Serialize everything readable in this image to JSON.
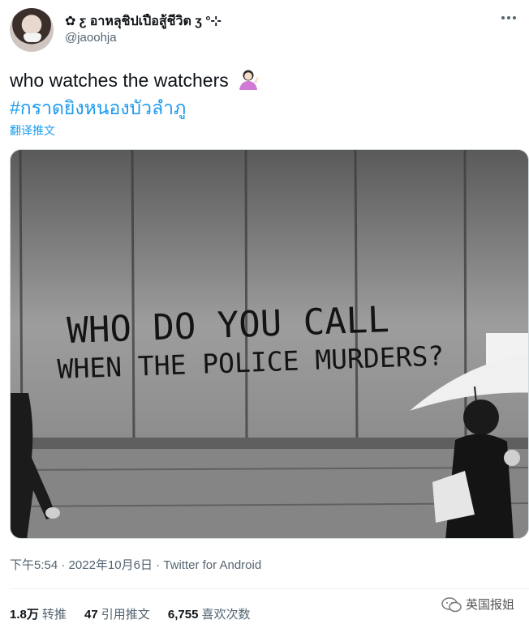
{
  "author": {
    "display_name": "✿ ƹ อาหลุชิปเปือสู้ชีวิต ʒ °⊹",
    "handle": "@jaoohja"
  },
  "tweet": {
    "text": "who watches the watchers",
    "emoji": "person-tipping-hand-emoji",
    "hashtag": "#กราดยิงหนองบัวลำภู",
    "translate_label": "翻译推文"
  },
  "photo": {
    "graffiti_line1": "WHO DO YOU CALL",
    "graffiti_line2": "WHEN THE POLICE MURDERS?"
  },
  "meta": {
    "time": "下午5:54",
    "sep1": " · ",
    "date": "2022年10月6日",
    "sep2": " · ",
    "source": "Twitter for Android"
  },
  "stats": {
    "retweets_count": "1.8万",
    "retweets_label": "转推",
    "quotes_count": "47",
    "quotes_label": "引用推文",
    "likes_count": "6,755",
    "likes_label": "喜欢次数"
  },
  "watermark": {
    "text": "英国报姐"
  },
  "colors": {
    "link": "#1d9bf0",
    "muted": "#536471",
    "text": "#0f1419"
  }
}
